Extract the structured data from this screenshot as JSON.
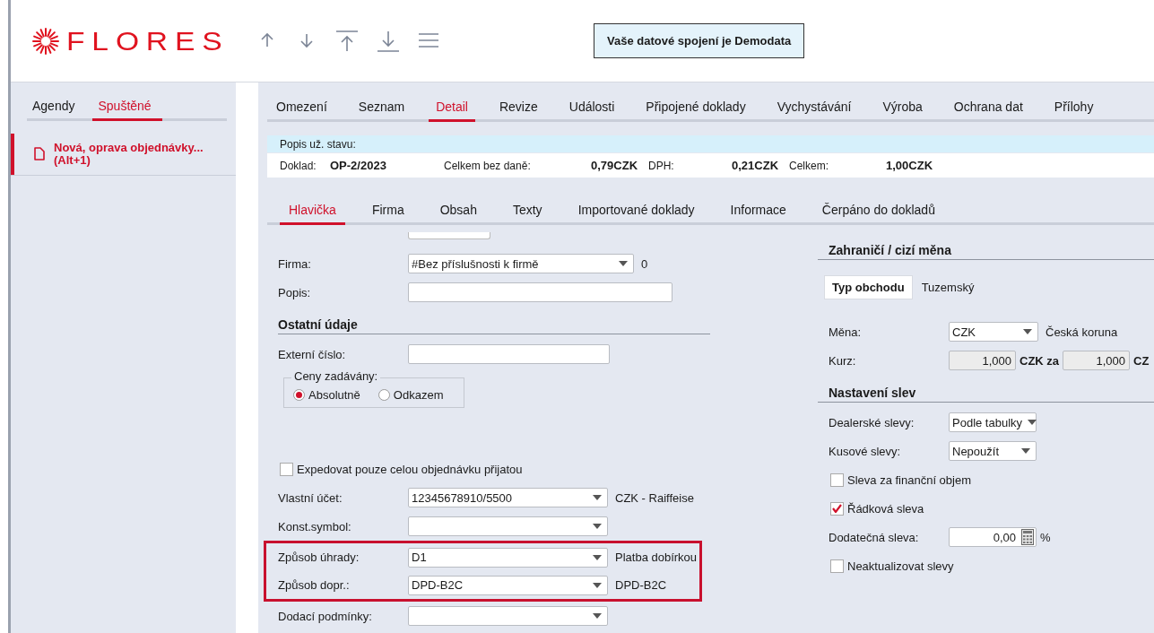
{
  "header": {
    "logo": "FLORES",
    "notice": "Vaše datové spojení je Demodata"
  },
  "sidebar": {
    "tabs": [
      {
        "label": "Agendy",
        "selected": false
      },
      {
        "label": "Spuštěné",
        "selected": true
      }
    ],
    "items": [
      {
        "title": "Nová, oprava objednávky...",
        "shortcut": "(Alt+1)",
        "selected": true
      }
    ]
  },
  "main_tabs": [
    {
      "label": "Omezení",
      "selected": false
    },
    {
      "label": "Seznam",
      "selected": false
    },
    {
      "label": "Detail",
      "selected": true
    },
    {
      "label": "Revize",
      "selected": false
    },
    {
      "label": "Události",
      "selected": false
    },
    {
      "label": "Připojené doklady",
      "selected": false
    },
    {
      "label": "Vychystávání",
      "selected": false
    },
    {
      "label": "Výroba",
      "selected": false
    },
    {
      "label": "Ochrana dat",
      "selected": false
    },
    {
      "label": "Přílohy",
      "selected": false
    }
  ],
  "status_bar": {
    "label": "Popis už. stavu:"
  },
  "summary": [
    {
      "label": "Doklad:",
      "value": "OP-2/2023"
    },
    {
      "label": "Celkem bez daně:",
      "value": "0,79CZK"
    },
    {
      "label": "DPH:",
      "value": "0,21CZK"
    },
    {
      "label": "Celkem:",
      "value": "1,00CZK"
    }
  ],
  "sub_tabs": [
    {
      "label": "Hlavička",
      "selected": true
    },
    {
      "label": "Firma",
      "selected": false
    },
    {
      "label": "Obsah",
      "selected": false
    },
    {
      "label": "Texty",
      "selected": false
    },
    {
      "label": "Importované doklady",
      "selected": false
    },
    {
      "label": "Informace",
      "selected": false
    },
    {
      "label": "Čerpáno do dokladů",
      "selected": false
    }
  ],
  "left_form": [
    {
      "kind": "combo",
      "label": "Firma:",
      "value": "#Bez příslušnosti k firmě",
      "note": "0",
      "highlighted": false
    },
    {
      "kind": "text",
      "label": "Popis:",
      "highlighted": false
    },
    {
      "kind": "heading",
      "label": "Ostatní údaje",
      "highlighted": false
    },
    {
      "kind": "text",
      "label": "Externí číslo:",
      "highlighted": false
    },
    {
      "kind": "radios",
      "label": "Ceny zadávány:",
      "options": [
        {
          "label": "Absolutně",
          "selected": true
        },
        {
          "label": "Odkazem",
          "selected": false
        }
      ],
      "highlighted": false
    },
    {
      "kind": "checkbox",
      "label": "Expedovat pouze celou objednávku přijatou",
      "checked": false,
      "highlighted": false
    },
    {
      "kind": "combo",
      "label": "Vlastní účet:",
      "value": "12345678910/5500",
      "note": "CZK - Raiffeise",
      "highlighted": false
    },
    {
      "kind": "combo",
      "label": "Konst.symbol:",
      "highlighted": false
    },
    {
      "kind": "combo",
      "label": "Způsob úhrady:",
      "value": "D1",
      "note": "Platba dobírkou",
      "highlighted": true
    },
    {
      "kind": "combo",
      "label": "Způsob dopr.:",
      "value": "DPD-B2C",
      "note": "DPD-B2C",
      "highlighted": true
    },
    {
      "kind": "combo",
      "label": "Dodací podmínky:",
      "highlighted": false
    }
  ],
  "right_form": [
    {
      "kind": "heading",
      "label": "Zahraničí / cizí měna"
    },
    {
      "kind": "button",
      "label": "Typ obchodu",
      "note": "Tuzemský"
    },
    {
      "kind": "combo",
      "label": "Měna:",
      "value": "CZK",
      "note": "Česká koruna"
    },
    {
      "kind": "rate",
      "label": "Kurz:",
      "value": "1,000",
      "unit": "CZK za",
      "value2": "1,000",
      "unit2": "CZ"
    },
    {
      "kind": "heading",
      "label": "Nastavení slev"
    },
    {
      "kind": "combo",
      "label": "Dealerské slevy:",
      "value": "Podle tabulky"
    },
    {
      "kind": "combo",
      "label": "Kusové slevy:",
      "value": "Nepoužít"
    },
    {
      "kind": "checkbox",
      "label": "Sleva za finanční objem",
      "checked": false
    },
    {
      "kind": "checkbox",
      "label": "Řádková sleva",
      "checked": true
    },
    {
      "kind": "number",
      "label": "Dodatečná sleva:",
      "value": "0,00",
      "unit": "%"
    },
    {
      "kind": "checkbox",
      "label": "Neaktualizovat slevy",
      "checked": false
    }
  ]
}
